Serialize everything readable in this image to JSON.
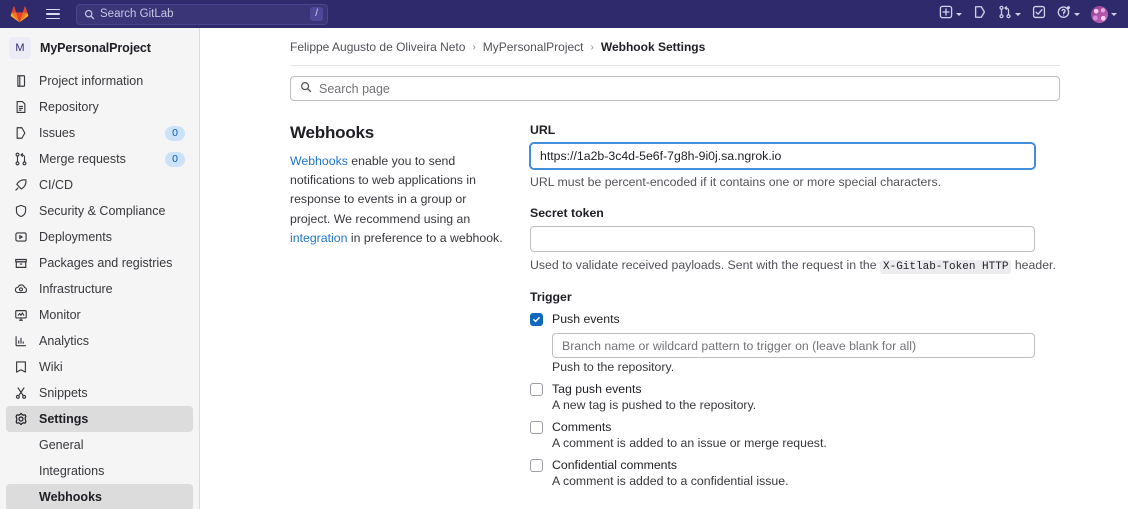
{
  "header": {
    "logo": "gitlab-fox-logo",
    "hamburger": "menu-icon",
    "search_placeholder": "Search GitLab",
    "search_shortcut": "/",
    "actions": [
      {
        "icon": "new-plus-icon",
        "has_caret": true
      },
      {
        "icon": "issues-icon",
        "has_caret": false
      },
      {
        "icon": "merge-requests-icon",
        "has_caret": true
      },
      {
        "icon": "todos-checkbox-icon",
        "has_caret": false
      },
      {
        "icon": "help-question-icon",
        "has_caret": true
      }
    ],
    "avatar": "user-avatar"
  },
  "sidebar": {
    "project_initial": "M",
    "project_name": "MyPersonalProject",
    "items": [
      {
        "label": "Project information",
        "icon": "book-icon",
        "badge": null,
        "active": false
      },
      {
        "label": "Repository",
        "icon": "document-icon",
        "badge": null,
        "active": false
      },
      {
        "label": "Issues",
        "icon": "issues-icon",
        "badge": "0",
        "active": false
      },
      {
        "label": "Merge requests",
        "icon": "merge-request-icon",
        "badge": "0",
        "active": false
      },
      {
        "label": "CI/CD",
        "icon": "rocket-icon",
        "badge": null,
        "active": false
      },
      {
        "label": "Security & Compliance",
        "icon": "shield-icon",
        "badge": null,
        "active": false
      },
      {
        "label": "Deployments",
        "icon": "deployments-icon",
        "badge": null,
        "active": false
      },
      {
        "label": "Packages and registries",
        "icon": "package-icon",
        "badge": null,
        "active": false
      },
      {
        "label": "Infrastructure",
        "icon": "cloud-gear-icon",
        "badge": null,
        "active": false
      },
      {
        "label": "Monitor",
        "icon": "monitor-icon",
        "badge": null,
        "active": false
      },
      {
        "label": "Analytics",
        "icon": "chart-icon",
        "badge": null,
        "active": false
      },
      {
        "label": "Wiki",
        "icon": "book-open-icon",
        "badge": null,
        "active": false
      },
      {
        "label": "Snippets",
        "icon": "scissors-icon",
        "badge": null,
        "active": false
      },
      {
        "label": "Settings",
        "icon": "gear-icon",
        "badge": null,
        "active": true
      }
    ],
    "settings_children": [
      {
        "label": "General",
        "active": false
      },
      {
        "label": "Integrations",
        "active": false
      },
      {
        "label": "Webhooks",
        "active": true
      }
    ]
  },
  "breadcrumb": {
    "items": [
      "Felippe Augusto de Oliveira Neto",
      "MyPersonalProject",
      "Webhook Settings"
    ],
    "separator": "›"
  },
  "search_page": {
    "placeholder": "Search page",
    "icon": "search-icon"
  },
  "webhooks_intro": {
    "title": "Webhooks",
    "link1": "Webhooks",
    "text1": " enable you to send notifications to web applications in response to events in a group or project. We recommend using an ",
    "link2": "integration",
    "text2": " in preference to a webhook."
  },
  "form": {
    "url": {
      "label": "URL",
      "value": "https://1a2b-3c4d-5e6f-7g8h-9i0j.sa.ngrok.io",
      "helper": "URL must be percent-encoded if it contains one or more special characters."
    },
    "secret_token": {
      "label": "Secret token",
      "value": "",
      "helper_before": "Used to validate received payloads. Sent with the request in the ",
      "helper_code": "X-Gitlab-Token HTTP",
      "helper_after": " header."
    },
    "trigger": {
      "label": "Trigger",
      "events": [
        {
          "name": "Push events",
          "checked": true,
          "branch_placeholder": "Branch name or wildcard pattern to trigger on (leave blank for all)",
          "description": "Push to the repository."
        },
        {
          "name": "Tag push events",
          "checked": false,
          "branch_placeholder": null,
          "description": "A new tag is pushed to the repository."
        },
        {
          "name": "Comments",
          "checked": false,
          "branch_placeholder": null,
          "description": "A comment is added to an issue or merge request."
        },
        {
          "name": "Confidential comments",
          "checked": false,
          "branch_placeholder": null,
          "description": "A comment is added to a confidential issue."
        }
      ]
    }
  },
  "colors": {
    "header_bg": "#2f2a6b",
    "sidebar_bg": "#f5f5f5",
    "link": "#1f75cb",
    "checkbox_checked": "#1068bf",
    "badge_bg": "#cbe2f9",
    "focus_border": "#428fdc"
  }
}
